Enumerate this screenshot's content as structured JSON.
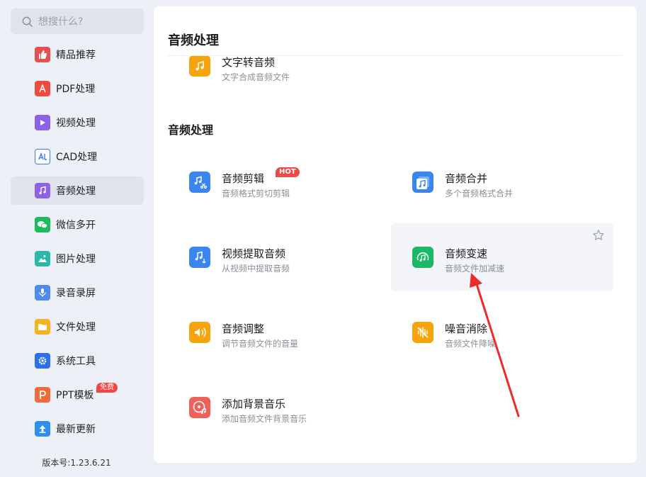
{
  "sidebar": {
    "search_placeholder": "想搜什么?",
    "items": [
      {
        "label": "精品推荐",
        "icon": "thumbs-up-icon",
        "color": "#e84f4f"
      },
      {
        "label": "PDF处理",
        "icon": "pdf-icon",
        "color": "#ef4b3f"
      },
      {
        "label": "视频处理",
        "icon": "play-icon",
        "color": "#8b62e8"
      },
      {
        "label": "CAD处理",
        "icon": "cad-icon",
        "color": "#3a7cf0"
      },
      {
        "label": "音频处理",
        "icon": "music-note-icon",
        "color": "#8b62e8"
      },
      {
        "label": "微信多开",
        "icon": "wechat-icon",
        "color": "#1cbb5e"
      },
      {
        "label": "图片处理",
        "icon": "image-icon",
        "color": "#2cb8a8"
      },
      {
        "label": "录音录屏",
        "icon": "microphone-icon",
        "color": "#4d8af0"
      },
      {
        "label": "文件处理",
        "icon": "folder-icon",
        "color": "#f7b21c"
      },
      {
        "label": "系统工具",
        "icon": "gear-icon",
        "color": "#2e6ff0"
      },
      {
        "label": "PPT模板",
        "icon": "ppt-icon",
        "color": "#f06a3c",
        "badge": "免费"
      },
      {
        "label": "最新更新",
        "icon": "upload-icon",
        "color": "#2e8ff0"
      }
    ],
    "version": "版本号:1.23.6.21"
  },
  "main": {
    "sticky_title": "音频处理",
    "partial_tool": {
      "name": "文字转音频",
      "desc": "文字合成音频文件"
    },
    "section_title": "音频处理",
    "tools": [
      {
        "name": "音频剪辑",
        "desc": "音频格式剪切剪辑",
        "icon": "audio-cut-icon",
        "color": "#3a86f0",
        "badge": "HOT"
      },
      {
        "name": "音频合并",
        "desc": "多个音频格式合并",
        "icon": "audio-merge-icon",
        "color": "#3a86f0"
      },
      {
        "name": "视频提取音频",
        "desc": "从视频中提取音频",
        "icon": "audio-extract-icon",
        "color": "#3a86f0"
      },
      {
        "name": "音频变速",
        "desc": "音频文件加减速",
        "icon": "audio-speed-icon",
        "color": "#1cb86a"
      },
      {
        "name": "音频调整",
        "desc": "调节音频文件的音量",
        "icon": "volume-icon",
        "color": "#f5a40c"
      },
      {
        "name": "噪音消除",
        "desc": "音频文件降噪",
        "icon": "noise-reduce-icon",
        "color": "#f5a40c"
      },
      {
        "name": "添加背景音乐",
        "desc": "添加音频文件背景音乐",
        "icon": "background-music-icon",
        "color": "#f0605a"
      }
    ]
  }
}
